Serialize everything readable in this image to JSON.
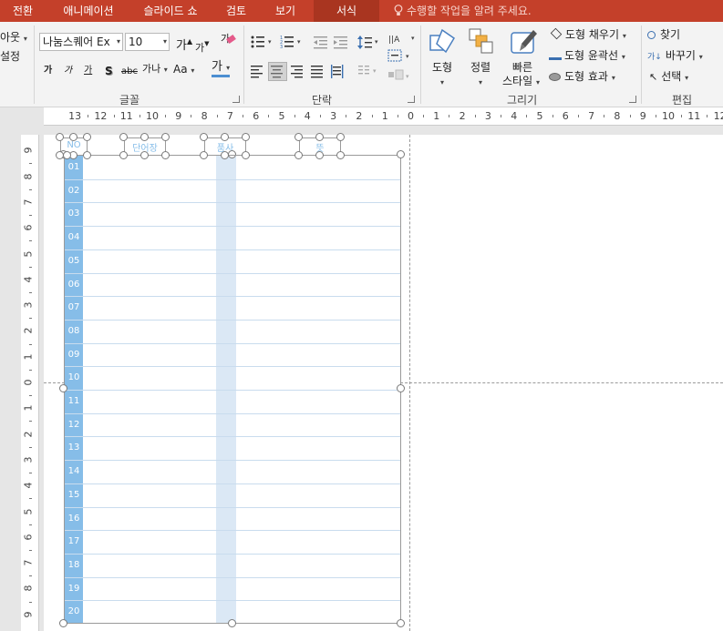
{
  "tabs": [
    {
      "label": "전환",
      "active": false
    },
    {
      "label": "애니메이션",
      "active": false
    },
    {
      "label": "슬라이드 쇼",
      "active": false
    },
    {
      "label": "검토",
      "active": false
    },
    {
      "label": "보기",
      "active": false
    },
    {
      "label": "서식",
      "active": true
    }
  ],
  "tell_me": "수행할 작업을 알려 주세요.",
  "left_partial": {
    "layout": "아웃",
    "reset": "설정"
  },
  "font": {
    "name": "나눔스퀘어 Ex",
    "size": "10",
    "grow": "가",
    "shrink": "가",
    "clear": "가",
    "bold": "가",
    "italic": "가",
    "underline": "가",
    "shadow": "S",
    "strike": "abc",
    "spacing": "가나",
    "case": "Aa",
    "color": "가",
    "group_label": "글꼴"
  },
  "paragraph": {
    "group_label": "단락"
  },
  "drawing": {
    "shape": "도형",
    "arrange": "정렬",
    "quick_style_1": "빠른",
    "quick_style_2": "스타일",
    "fill": "도형 채우기",
    "outline": "도형 윤곽선",
    "effects": "도형 효과",
    "group_label": "그리기"
  },
  "editing": {
    "find": "찾기",
    "replace": "바꾸기",
    "select": "선택",
    "group_label": "편집"
  },
  "ruler": {
    "h": [
      "13",
      "12",
      "11",
      "10",
      "9",
      "8",
      "7",
      "6",
      "5",
      "4",
      "3",
      "2",
      "1",
      "0",
      "1",
      "2",
      "3",
      "4",
      "5",
      "6",
      "7",
      "8",
      "9",
      "10",
      "11",
      "12"
    ],
    "v": [
      "9",
      "8",
      "7",
      "6",
      "5",
      "4",
      "3",
      "2",
      "1",
      "0",
      "1",
      "2",
      "3",
      "4",
      "5",
      "6",
      "7",
      "8",
      "9"
    ]
  },
  "table": {
    "headers": {
      "no": "NO",
      "word": "단어장",
      "pos": "품사",
      "meaning": "뜻"
    },
    "rows": [
      "01",
      "02",
      "03",
      "04",
      "05",
      "06",
      "07",
      "08",
      "09",
      "10",
      "11",
      "12",
      "13",
      "14",
      "15",
      "16",
      "17",
      "18",
      "19",
      "20"
    ]
  },
  "colors": {
    "accent": "#c4402a",
    "table_blue": "#86bde8",
    "table_band": "#dbe8f5"
  }
}
